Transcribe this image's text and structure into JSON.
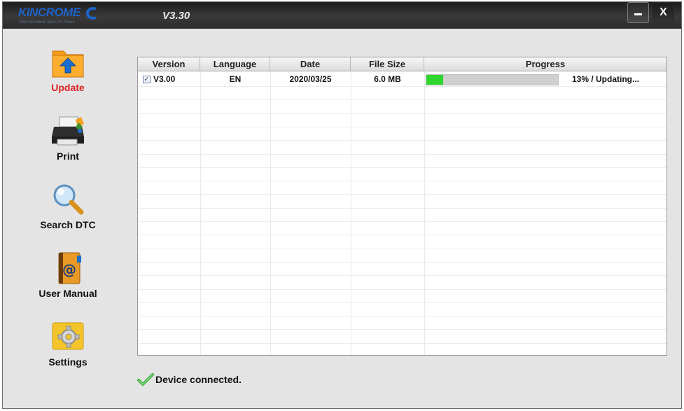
{
  "app": {
    "logo_text": "KINCROME",
    "logo_tagline": "PROFESSIONAL QUALITY TOOLS",
    "version": "V3.30",
    "minimize_icon": "minimize-icon",
    "close_label": "X"
  },
  "nav": [
    {
      "label": "Update",
      "icon": "update-icon",
      "active": true
    },
    {
      "label": "Print",
      "icon": "printer-icon",
      "active": false
    },
    {
      "label": "Search DTC",
      "icon": "magnifier-icon",
      "active": false
    },
    {
      "label": "User Manual",
      "icon": "address-book-icon",
      "active": false
    },
    {
      "label": "Settings",
      "icon": "gear-icon",
      "active": false
    }
  ],
  "table": {
    "columns": [
      "Version",
      "Language",
      "Date",
      "File Size",
      "Progress"
    ],
    "rows": [
      {
        "checked": true,
        "version": "V3.00",
        "language": "EN",
        "date": "2020/03/25",
        "file_size": "6.0 MB",
        "progress_fraction": 0.13,
        "progress_text": "13% / Updating..."
      }
    ]
  },
  "status": {
    "text": "Device connected.",
    "icon": "checkmark-icon"
  },
  "colors": {
    "accent_active": "#e02222",
    "progress_fill": "#2fd62f",
    "titlebar": "#2b2b2b"
  }
}
